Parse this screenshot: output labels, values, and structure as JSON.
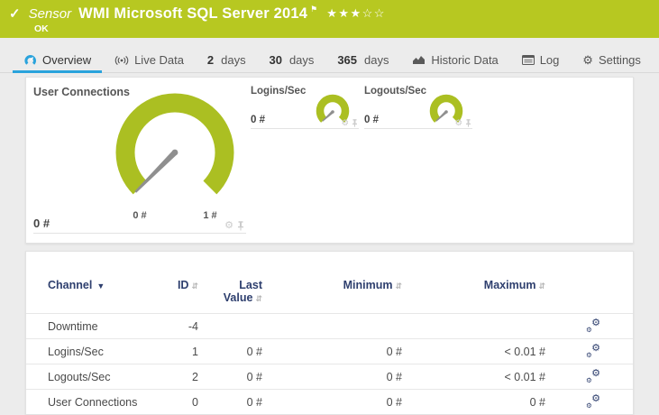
{
  "colors": {
    "status_green": "#b7c821",
    "gauge_green": "#abbf22",
    "accent_blue": "#2aa3dc",
    "navy": "#2e3f6e",
    "needle_gray": "#8f8f8f"
  },
  "header": {
    "kind_label": "Sensor",
    "title": "WMI Microsoft SQL Server 2014",
    "status": "OK",
    "rating": "★★★☆☆"
  },
  "tabs": [
    {
      "label": "Overview",
      "icon": "gauge-icon",
      "active": true
    },
    {
      "label": "Live Data",
      "icon": "broadcast-icon",
      "active": false
    },
    {
      "num": "2",
      "unit": "days",
      "active": false
    },
    {
      "num": "30",
      "unit": "days",
      "active": false
    },
    {
      "num": "365",
      "unit": "days",
      "active": false
    },
    {
      "label": "Historic Data",
      "icon": "area-chart-icon",
      "active": false
    },
    {
      "label": "Log",
      "icon": "log-icon",
      "active": false
    },
    {
      "label": "Settings",
      "icon": "gear-icon",
      "active": false
    }
  ],
  "gauges": {
    "primary": {
      "title": "User Connections",
      "value": "0 #",
      "scale_min": "0 #",
      "scale_max": "1 #"
    },
    "small": [
      {
        "title": "Logins/Sec",
        "value": "0 #"
      },
      {
        "title": "Logouts/Sec",
        "value": "0 #"
      }
    ]
  },
  "table": {
    "headers": {
      "channel": "Channel",
      "id": "ID",
      "last_value": "Last Value",
      "minimum": "Minimum",
      "maximum": "Maximum"
    },
    "rows": [
      {
        "channel": "Downtime",
        "id": "-4",
        "last_value": "",
        "minimum": "",
        "maximum": ""
      },
      {
        "channel": "Logins/Sec",
        "id": "1",
        "last_value": "0 #",
        "minimum": "0 #",
        "maximum": "< 0.01 #"
      },
      {
        "channel": "Logouts/Sec",
        "id": "2",
        "last_value": "0 #",
        "minimum": "0 #",
        "maximum": "< 0.01 #"
      },
      {
        "channel": "User Connections",
        "id": "0",
        "last_value": "0 #",
        "minimum": "0 #",
        "maximum": "0 #"
      }
    ]
  }
}
